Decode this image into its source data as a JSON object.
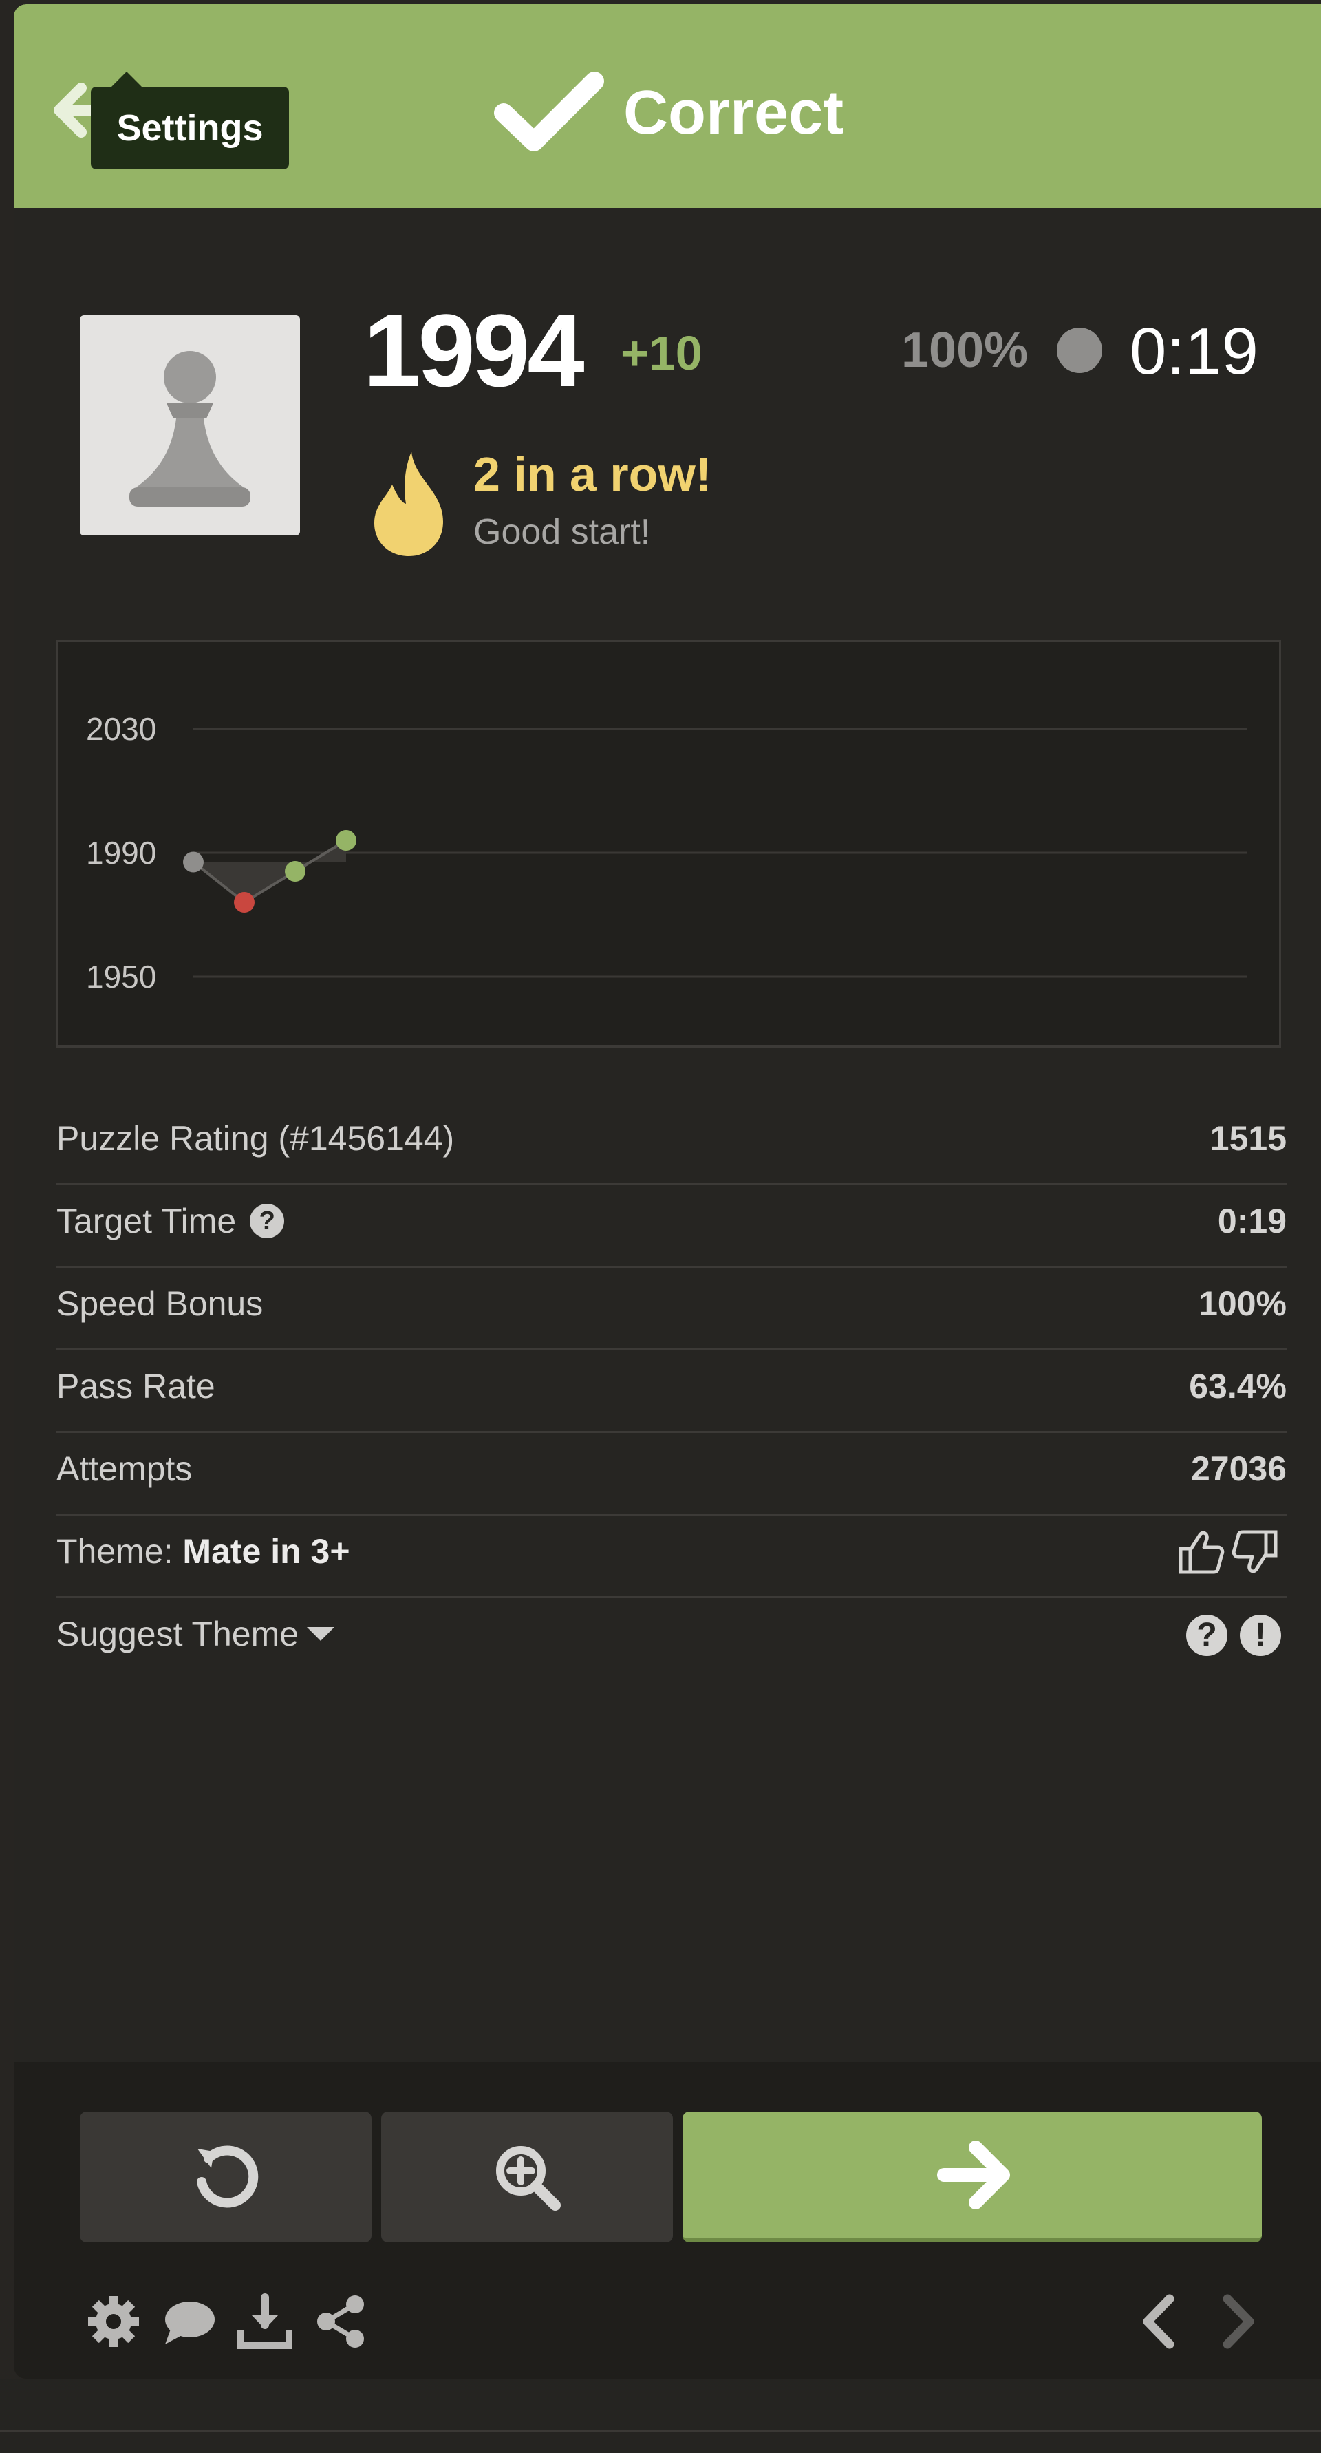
{
  "header": {
    "tooltip": "Settings",
    "status_label": "Correct",
    "back_icon": "arrow-left-icon",
    "status_icon": "checkmark-icon",
    "colors": {
      "header_bg": "#95b466",
      "tooltip_bg": "#1f2e16"
    }
  },
  "rating": {
    "value": "1994",
    "delta": "+10",
    "speed_percent": "100%",
    "clock": "0:19",
    "streak_title": "2 in a row!",
    "streak_sub": "Good start!",
    "colors": {
      "delta": "#95b466",
      "streak": "#f1d270"
    }
  },
  "chart_data": {
    "type": "line",
    "ylim": [
      1950,
      2030
    ],
    "y_ticks": [
      "2030",
      "1990",
      "1950"
    ],
    "x": [
      1,
      2,
      3,
      4
    ],
    "values": [
      1987,
      1974,
      1984,
      1994
    ],
    "point_colors": [
      "#8f8e8c",
      "#c9473f",
      "#95b466",
      "#95b466"
    ],
    "grid": true
  },
  "stats": {
    "puzzle_rating_label": "Puzzle Rating (#1456144)",
    "puzzle_rating_value": "1515",
    "target_time_label": "Target Time",
    "target_time_value": "0:19",
    "speed_bonus_label": "Speed Bonus",
    "speed_bonus_value": "100%",
    "pass_rate_label": "Pass Rate",
    "pass_rate_value": "63.4%",
    "attempts_label": "Attempts",
    "attempts_value": "27036",
    "theme_label": "Theme:",
    "theme_value": "Mate in 3+",
    "suggest_label": "Suggest Theme",
    "help_glyph": "?",
    "report_glyph": "!"
  },
  "footer": {
    "buttons": [
      "retry-icon",
      "analysis-icon",
      "next-arrow-icon"
    ],
    "tools": [
      "gear-icon",
      "chat-icon",
      "download-icon",
      "share-icon",
      "chevron-left-icon",
      "chevron-right-icon"
    ]
  }
}
